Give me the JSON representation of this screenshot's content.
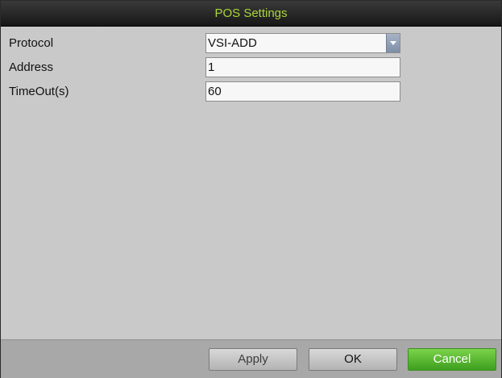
{
  "window": {
    "title": "POS Settings"
  },
  "form": {
    "protocol": {
      "label": "Protocol",
      "value": "VSI-ADD"
    },
    "address": {
      "label": "Address",
      "value": "1"
    },
    "timeout": {
      "label": "TimeOut(s)",
      "value": "60"
    }
  },
  "footer": {
    "apply_label": "Apply",
    "ok_label": "OK",
    "cancel_label": "Cancel"
  },
  "colors": {
    "title_text": "#a9d63a",
    "accent_cancel": "#4caf2a"
  },
  "icons": {
    "dropdown": "chevron-down-icon"
  }
}
